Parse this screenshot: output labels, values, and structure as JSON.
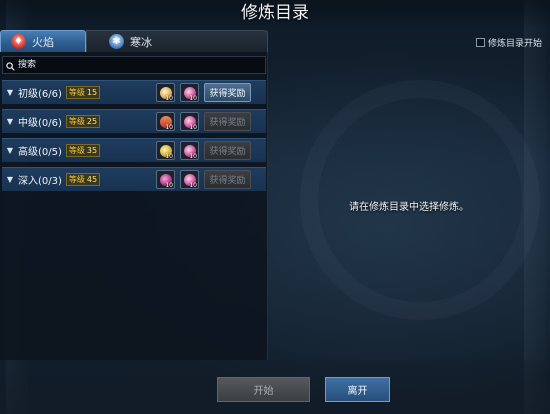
{
  "window": {
    "title": "修炼目录"
  },
  "tabs": [
    {
      "label": "火焰",
      "icon": "fire-icon",
      "active": true
    },
    {
      "label": "寒冰",
      "icon": "snowflake-icon",
      "active": false
    }
  ],
  "search": {
    "placeholder": "搜索",
    "icon": "search-icon"
  },
  "training_list": [
    {
      "name": "初级(6/6)",
      "level_label": "等级",
      "level": "15",
      "items": [
        {
          "icon": "scroll-item-icon",
          "count": "10"
        },
        {
          "icon": "flask-item-icon",
          "count": "10"
        }
      ],
      "reward_label": "获得奖励",
      "reward_enabled": true
    },
    {
      "name": "中级(0/6)",
      "level_label": "等级",
      "level": "25",
      "items": [
        {
          "icon": "sword-item-icon",
          "count": "10"
        },
        {
          "icon": "flask-item-icon",
          "count": "10"
        }
      ],
      "reward_label": "获得奖励",
      "reward_enabled": false
    },
    {
      "name": "高级(0/5)",
      "level_label": "等级",
      "level": "35",
      "items": [
        {
          "icon": "quill-item-icon",
          "count": "10"
        },
        {
          "icon": "flask-item-icon",
          "count": "10"
        }
      ],
      "reward_label": "获得奖励",
      "reward_enabled": false
    },
    {
      "name": "深入(0/3)",
      "level_label": "等级",
      "level": "45",
      "items": [
        {
          "icon": "potion-item-icon",
          "count": "10"
        },
        {
          "icon": "flask-item-icon",
          "count": "10"
        }
      ],
      "reward_label": "获得奖励",
      "reward_enabled": false
    }
  ],
  "right_panel": {
    "checkbox_label": "修炼目录开始",
    "hint": "请在修炼目录中选择修炼。"
  },
  "footer": {
    "start_label": "开始",
    "leave_label": "离开"
  },
  "colors": {
    "accent_blue": "#2d5f92",
    "level_gold": "#f5c73a",
    "row_bg": "#1f3c5e",
    "disabled_gray": "#3b3f44"
  }
}
